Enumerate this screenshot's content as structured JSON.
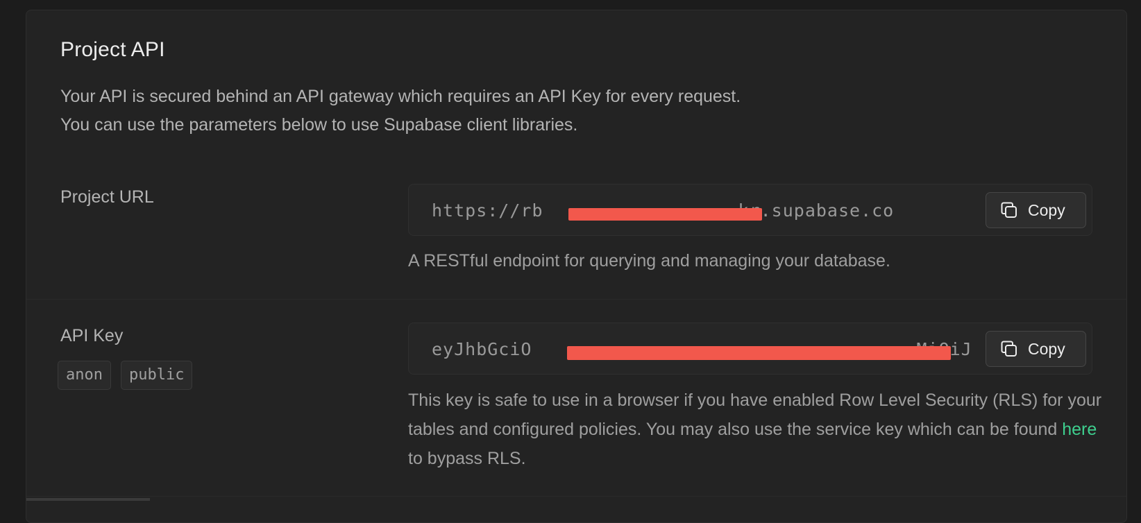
{
  "section": {
    "title": "Project API",
    "description_line1": "Your API is secured behind an API gateway which requires an API Key for every request.",
    "description_line2": "You can use the parameters below to use Supabase client libraries."
  },
  "project_url": {
    "label": "Project URL",
    "value_prefix": "https://rb",
    "value_suffix": "kr.supabase.co",
    "copy_label": "Copy",
    "help": "A RESTful endpoint for querying and managing your database."
  },
  "api_key": {
    "label": "API Key",
    "tags": [
      "anon",
      "public"
    ],
    "value_prefix": "eyJhbGciO",
    "value_suffix": "MiOiJ",
    "copy_label": "Copy",
    "help_part1": "This key is safe to use in a browser if you have enabled Row Level Security (RLS) for your tables and configured policies. You may also use the service key which can be found ",
    "help_link": "here",
    "help_part2": " to bypass RLS."
  },
  "colors": {
    "background": "#1c1c1c",
    "panel": "#232323",
    "link": "#3ecf8e",
    "redaction": "#f2584c"
  },
  "icons": {
    "copy": "copy-icon"
  }
}
